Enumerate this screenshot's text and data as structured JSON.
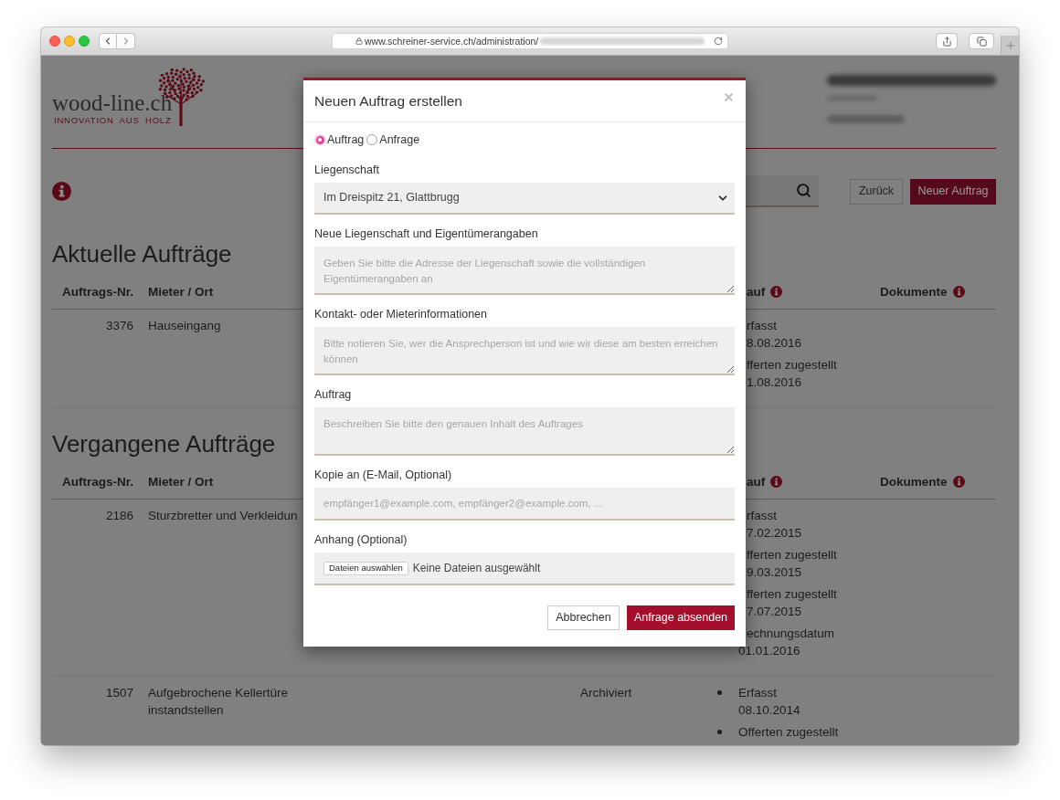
{
  "browser": {
    "url": "www.schreiner-service.ch/administration/"
  },
  "header": {
    "logo": "wood-line.ch",
    "tagline": "INNOVATION AUS HOLZ"
  },
  "toolbar": {
    "buttons": [
      {
        "label": "Zurück",
        "kind": "secondary"
      },
      {
        "label": "Neuer Auftrag",
        "kind": "primary"
      }
    ]
  },
  "sections": [
    {
      "title": "Aktuelle Aufträge",
      "columns": [
        {
          "label": "Auftrags-Nr.",
          "kind": "number",
          "info": false
        },
        {
          "label": "Mieter / Ort",
          "kind": "text",
          "info": false
        },
        {
          "label": "auf",
          "kind": "cut",
          "info": true
        },
        {
          "label": "Dokumente",
          "kind": "text",
          "info": true
        }
      ],
      "rows": [
        {
          "number": "3376",
          "tenant": "Hauseingang",
          "history": [
            {
              "label": "rfasst",
              "date": "8.08.2016",
              "kind": "covered"
            },
            {
              "label": "fferten zugestellt",
              "date": "1.08.2016",
              "kind": "covered"
            }
          ]
        }
      ]
    },
    {
      "title": "Vergangene Aufträge",
      "columns": [
        {
          "label": "Auftrags-Nr.",
          "kind": "number",
          "info": false
        },
        {
          "label": "Mieter / Ort",
          "kind": "text",
          "info": false
        },
        {
          "label": "auf",
          "kind": "cut",
          "info": true
        },
        {
          "label": "Dokumente",
          "kind": "text",
          "info": true
        }
      ],
      "rows": [
        {
          "number": "2186",
          "tenant": "Sturzbretter und Verkleidun",
          "history": [
            {
              "label": "rfasst",
              "date": "7.02.2015",
              "kind": "covered"
            },
            {
              "label": "fferten zugestellt",
              "date": "9.03.2015",
              "kind": "covered"
            },
            {
              "label": "fferten zugestellt",
              "date": "7.07.2015",
              "kind": "covered"
            },
            {
              "label": "echnungsdatum",
              "date": "01.01.2016",
              "kind": "half_covered"
            }
          ]
        },
        {
          "number": "1507",
          "tenant": "Aufgebrochene Kellertüre instandstellen",
          "status": "Archiviert",
          "history": [
            {
              "label": "Erfasst",
              "date": "08.10.2014",
              "kind": "full"
            },
            {
              "label": "Offerten zugestellt",
              "kind": "full"
            }
          ]
        }
      ]
    }
  ],
  "modal": {
    "title": "Neuen Auftrag erstellen",
    "order_type": [
      {
        "label": "Auftrag",
        "selected": true
      },
      {
        "label": "Anfrage",
        "selected": false
      }
    ],
    "fields": [
      {
        "label": "Liegenschaft",
        "kind": "select",
        "value": "Im Dreispitz 21, Glattbrugg"
      },
      {
        "label": "Neue Liegenschaft und Eigentümerangaben",
        "kind": "textarea",
        "placeholder": "Geben Sie bitte die Adresse der Liegenschaft sowie die vollständigen Eigentümerangaben an"
      },
      {
        "label": "Kontakt- oder Mieterinformationen",
        "kind": "textarea",
        "placeholder": "Bitte notieren Sie, wer die Ansprechperson ist und wie wir diese am besten erreichen können"
      },
      {
        "label": "Auftrag",
        "kind": "textarea",
        "placeholder": "Beschreiben Sie bitte den genauen Inhalt des Auftrages"
      },
      {
        "label": "Kopie an (E-Mail, Optional)",
        "kind": "input",
        "placeholder": "empfänger1@example.com, empfänger2@example.com, ..."
      },
      {
        "label": "Anhang (Optional)",
        "kind": "file",
        "button": "Dateien auswählen",
        "status": "Keine Dateien ausgewählt"
      }
    ],
    "buttons": [
      {
        "label": "Abbrechen",
        "kind": "secondary"
      },
      {
        "label": "Anfrage absenden",
        "kind": "primary"
      }
    ]
  }
}
